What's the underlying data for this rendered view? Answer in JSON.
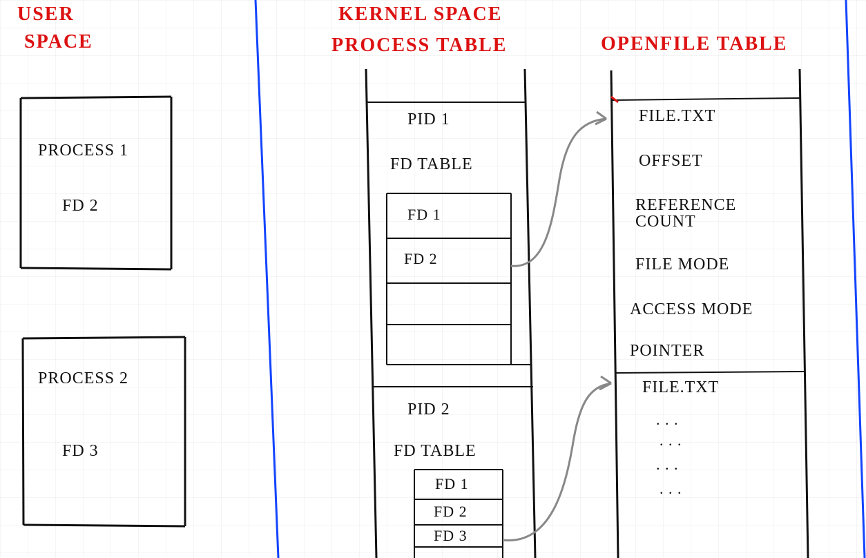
{
  "titles": {
    "user_space_1": "USER",
    "user_space_2": "SPACE",
    "kernel_space": "KERNEL SPACE",
    "process_table": "PROCESS TABLE",
    "openfile_table": "OPENFILE TABLE"
  },
  "user_space": {
    "process1": {
      "label": "PROCESS 1",
      "fd": "FD 2"
    },
    "process2": {
      "label": "PROCESS 2",
      "fd": "FD 3"
    }
  },
  "process_table": {
    "p1": {
      "pid": "PID 1",
      "fd_table_label": "FD TABLE",
      "rows": [
        "FD 1",
        "FD 2",
        "",
        ""
      ]
    },
    "p2": {
      "pid": "PID 2",
      "fd_table_label": "FD TABLE",
      "rows": [
        "FD 1",
        "FD 2",
        "FD 3"
      ]
    }
  },
  "openfile_table": {
    "entry1": {
      "name": "FILE.TXT",
      "fields": [
        "OFFSET",
        "REFERENCE COUNT",
        "FILE MODE",
        "ACCESS MODE",
        "POINTER"
      ]
    },
    "entry2": {
      "name": "FILE.TXT",
      "ellipsis": [
        ". . .",
        ". . .",
        ". . .",
        ". . ."
      ]
    }
  },
  "colors": {
    "heading": "#d11",
    "ink": "#111",
    "divider": "#1344ff",
    "arrow": "#888"
  }
}
